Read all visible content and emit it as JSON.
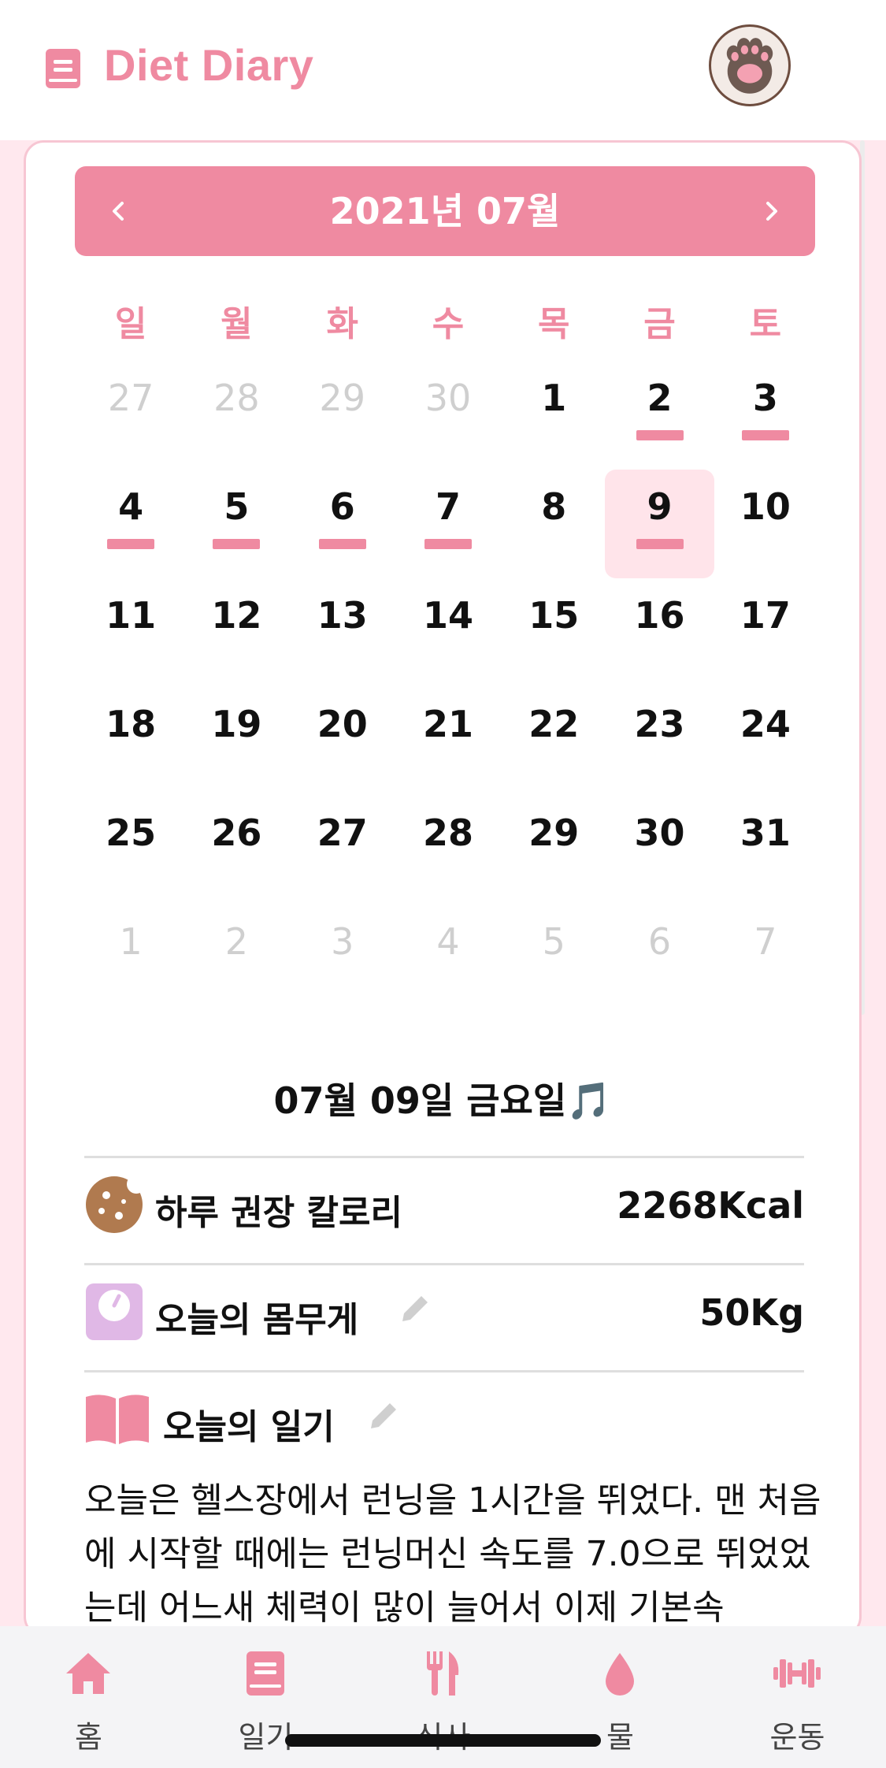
{
  "header": {
    "app_title": "Diet Diary",
    "logo_icon": "diary-book-icon",
    "avatar_icon": "cat-paw-icon"
  },
  "calendar": {
    "month_title": "2021년 07월",
    "prev_symbol": "‹",
    "next_symbol": "›",
    "weekdays": [
      "일",
      "월",
      "화",
      "수",
      "목",
      "금",
      "토"
    ],
    "weeks": [
      [
        {
          "d": "27",
          "muted": true
        },
        {
          "d": "28",
          "muted": true
        },
        {
          "d": "29",
          "muted": true
        },
        {
          "d": "30",
          "muted": true
        },
        {
          "d": "1"
        },
        {
          "d": "2",
          "mark": true
        },
        {
          "d": "3",
          "mark": true
        }
      ],
      [
        {
          "d": "4",
          "mark": true
        },
        {
          "d": "5",
          "mark": true
        },
        {
          "d": "6",
          "mark": true
        },
        {
          "d": "7",
          "mark": true
        },
        {
          "d": "8"
        },
        {
          "d": "9",
          "mark": true,
          "selected": true
        },
        {
          "d": "10"
        }
      ],
      [
        {
          "d": "11"
        },
        {
          "d": "12"
        },
        {
          "d": "13"
        },
        {
          "d": "14"
        },
        {
          "d": "15"
        },
        {
          "d": "16"
        },
        {
          "d": "17"
        }
      ],
      [
        {
          "d": "18"
        },
        {
          "d": "19"
        },
        {
          "d": "20"
        },
        {
          "d": "21"
        },
        {
          "d": "22"
        },
        {
          "d": "23"
        },
        {
          "d": "24"
        }
      ],
      [
        {
          "d": "25"
        },
        {
          "d": "26"
        },
        {
          "d": "27"
        },
        {
          "d": "28"
        },
        {
          "d": "29"
        },
        {
          "d": "30"
        },
        {
          "d": "31"
        }
      ],
      [
        {
          "d": "1",
          "muted": true
        },
        {
          "d": "2",
          "muted": true
        },
        {
          "d": "3",
          "muted": true
        },
        {
          "d": "4",
          "muted": true
        },
        {
          "d": "5",
          "muted": true
        },
        {
          "d": "6",
          "muted": true
        },
        {
          "d": "7",
          "muted": true
        }
      ]
    ]
  },
  "day": {
    "heading": "07월 09일 금요일🎵",
    "calorie_label": "하루 권장 칼로리",
    "calorie_value": "2268Kcal",
    "weight_label": "오늘의 몸무게",
    "weight_value": "50Kg",
    "diary_label": "오늘의 일기",
    "diary_text": "오늘은 헬스장에서 런닝을 1시간을 뛰었다. 맨 처음에 시작할 때에는 런닝머신 속도를 7.0으로 뛰었었는데 어느새 체력이 많이 늘어서 이제 기본속"
  },
  "tabs": [
    {
      "label": "홈",
      "icon": "home-icon"
    },
    {
      "label": "일기",
      "icon": "diary-icon"
    },
    {
      "label": "식사",
      "icon": "fork-knife-icon"
    },
    {
      "label": "물",
      "icon": "water-drop-icon"
    },
    {
      "label": "운동",
      "icon": "dumbbell-icon"
    }
  ],
  "colors": {
    "accent": "#ef8aa1",
    "selected_bg": "#ffe4ea",
    "page_bg": "#ffe8ee"
  }
}
